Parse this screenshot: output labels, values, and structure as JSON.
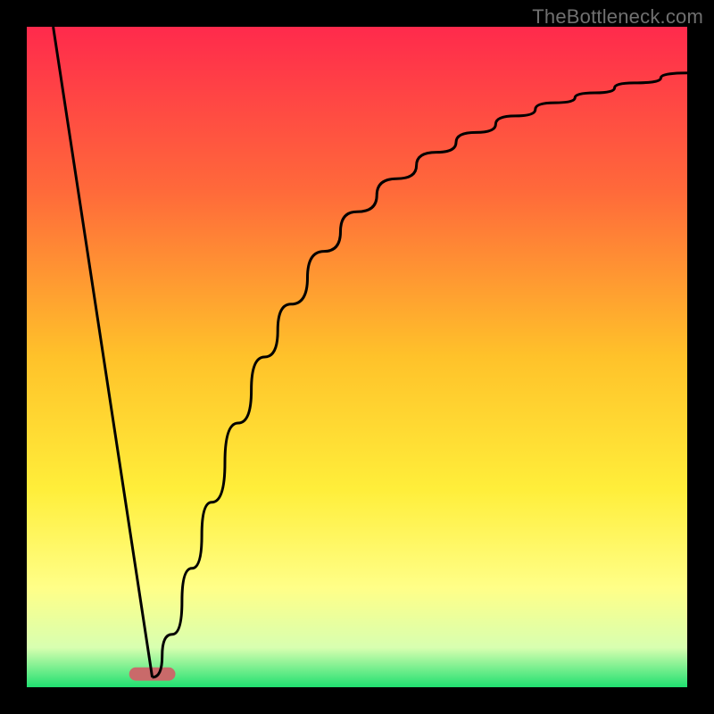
{
  "watermark": "TheBottleneck.com",
  "chart_data": {
    "type": "line",
    "title": "",
    "xlabel": "",
    "ylabel": "",
    "xlim": [
      0,
      100
    ],
    "ylim": [
      0,
      100
    ],
    "grid": false,
    "legend": false,
    "background_gradient": {
      "stops": [
        {
          "pos": 0.0,
          "color": "#ff2a4c"
        },
        {
          "pos": 0.25,
          "color": "#ff6a3a"
        },
        {
          "pos": 0.5,
          "color": "#ffc22a"
        },
        {
          "pos": 0.7,
          "color": "#ffee3a"
        },
        {
          "pos": 0.85,
          "color": "#ffff88"
        },
        {
          "pos": 0.94,
          "color": "#d8ffb0"
        },
        {
          "pos": 1.0,
          "color": "#20e070"
        }
      ]
    },
    "sweet_spot_marker": {
      "x_center": 19,
      "x_width": 7,
      "color": "#c96a6a"
    },
    "series": [
      {
        "name": "left-descending-line",
        "x": [
          4,
          19
        ],
        "y": [
          100,
          1.5
        ]
      },
      {
        "name": "right-log-curve",
        "x": [
          19,
          22,
          25,
          28,
          32,
          36,
          40,
          45,
          50,
          56,
          62,
          68,
          74,
          80,
          86,
          92,
          100
        ],
        "y": [
          1.5,
          8,
          18,
          28,
          40,
          50,
          58,
          66,
          72,
          77,
          81,
          84,
          86.5,
          88.5,
          90,
          91.5,
          93
        ]
      }
    ]
  }
}
